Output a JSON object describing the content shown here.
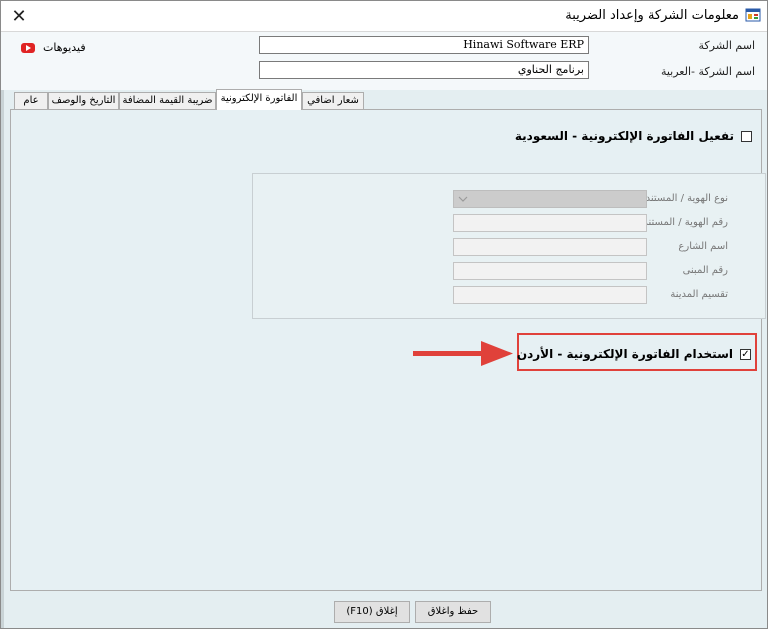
{
  "window": {
    "title": "معلومات الشركة وإعداد الضريبة",
    "close_glyph": "✕"
  },
  "header": {
    "videos_label": "فيديوهات",
    "company_name_label": "اسم الشركة",
    "company_name_value": "Hinawi Software ERP",
    "company_name_ar_label": "اسم الشركة -العربية",
    "company_name_ar_value": "برنامج الحناوي"
  },
  "tabs": [
    {
      "label": "عام",
      "active": false
    },
    {
      "label": "التاريخ والوصف",
      "active": false
    },
    {
      "label": "ضريبة القيمة المضافة",
      "active": false
    },
    {
      "label": "الفاتورة الإلكترونية",
      "active": true
    },
    {
      "label": "شعار اضافي",
      "active": false
    }
  ],
  "einvoice": {
    "saudi_checkbox_label": "تفعيل الفاتورة الإلكترونية - السعودية",
    "saudi_checked": false,
    "fields": [
      {
        "label": "نوع الهوية / المستند",
        "kind": "select",
        "value": ""
      },
      {
        "label": "رقم الهوية / المستند",
        "kind": "text",
        "value": ""
      },
      {
        "label": "اسم الشارع",
        "kind": "text",
        "value": ""
      },
      {
        "label": "رقم المبنى",
        "kind": "text",
        "value": ""
      },
      {
        "label": "تقسيم المدينة",
        "kind": "text",
        "value": ""
      }
    ],
    "jordan_checkbox_label": "استخدام الفاتورة الإلكترونية - الأردن",
    "jordan_checked": true,
    "check_glyph": "✓"
  },
  "footer": {
    "save_close_label": "حفظ واغلاق",
    "close_label": "إغلاق (F10)"
  },
  "colors": {
    "highlight": "#e0413a",
    "arrow": "#e0413a",
    "youtube": "#e02424"
  },
  "icons": {
    "app": "app-window-icon",
    "youtube": "youtube-icon",
    "dropdown": "chevron-down-icon",
    "arrow": "pointer-arrow-icon"
  }
}
